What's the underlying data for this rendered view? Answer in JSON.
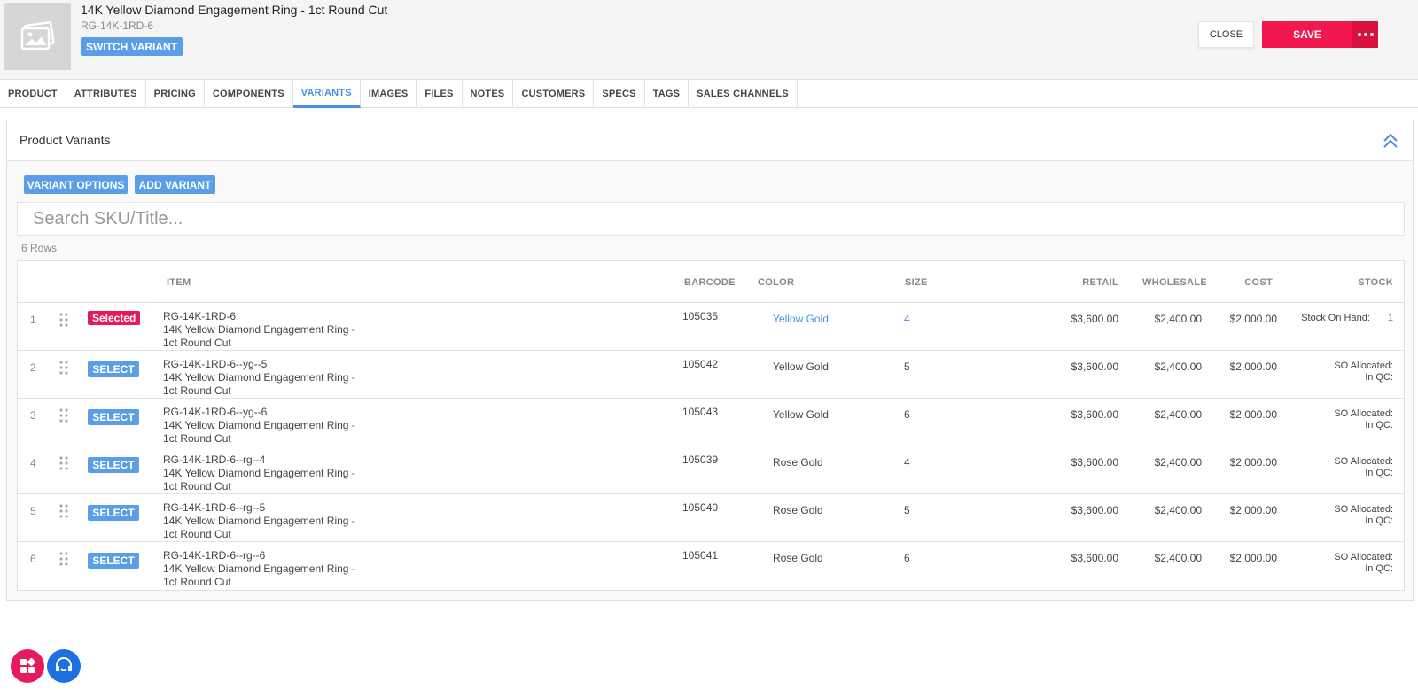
{
  "product": {
    "title": "14K Yellow Diamond Engagement Ring - 1ct Round Cut",
    "sku": "RG-14K-1RD-6",
    "switch_variant_label": "SWITCH VARIANT"
  },
  "actions": {
    "close_label": "CLOSE",
    "save_label": "SAVE"
  },
  "tabs": [
    {
      "label": "PRODUCT"
    },
    {
      "label": "ATTRIBUTES"
    },
    {
      "label": "PRICING"
    },
    {
      "label": "COMPONENTS"
    },
    {
      "label": "VARIANTS",
      "active": true
    },
    {
      "label": "IMAGES"
    },
    {
      "label": "FILES"
    },
    {
      "label": "NOTES"
    },
    {
      "label": "CUSTOMERS"
    },
    {
      "label": "SPECS"
    },
    {
      "label": "TAGS"
    },
    {
      "label": "SALES CHANNELS"
    }
  ],
  "panel": {
    "title": "Product Variants",
    "variant_options_label": "VARIANT OPTIONS",
    "add_variant_label": "ADD VARIANT",
    "search_placeholder": "Search SKU/Title...",
    "rows_count": "6 Rows"
  },
  "table": {
    "headers": {
      "item": "ITEM",
      "barcode": "BARCODE",
      "color": "COLOR",
      "size": "SIZE",
      "retail": "RETAIL",
      "wholesale": "WHOLESALE",
      "cost": "COST",
      "stock": "STOCK"
    },
    "select_label": "SELECT",
    "selected_label": "Selected",
    "rows": [
      {
        "num": "1",
        "sku": "RG-14K-1RD-6",
        "title1": "14K Yellow Diamond Engagement Ring -",
        "title2": "1ct Round Cut",
        "barcode": "105035",
        "color": "Yellow Gold",
        "size": "4",
        "retail": "$3,600.00",
        "wholesale": "$2,400.00",
        "cost": "$2,000.00",
        "stock1": "Stock On Hand:",
        "stock_value": "1",
        "selected": true
      },
      {
        "num": "2",
        "sku": "RG-14K-1RD-6--yg--5",
        "title1": "14K Yellow Diamond Engagement Ring -",
        "title2": "1ct Round Cut",
        "barcode": "105042",
        "color": "Yellow Gold",
        "size": "5",
        "retail": "$3,600.00",
        "wholesale": "$2,400.00",
        "cost": "$2,000.00",
        "stock1": "SO Allocated:",
        "stock2": "In QC:"
      },
      {
        "num": "3",
        "sku": "RG-14K-1RD-6--yg--6",
        "title1": "14K Yellow Diamond Engagement Ring -",
        "title2": "1ct Round Cut",
        "barcode": "105043",
        "color": "Yellow Gold",
        "size": "6",
        "retail": "$3,600.00",
        "wholesale": "$2,400.00",
        "cost": "$2,000.00",
        "stock1": "SO Allocated:",
        "stock2": "In QC:"
      },
      {
        "num": "4",
        "sku": "RG-14K-1RD-6--rg--4",
        "title1": "14K Yellow Diamond Engagement Ring -",
        "title2": "1ct Round Cut",
        "barcode": "105039",
        "color": "Rose Gold",
        "size": "4",
        "retail": "$3,600.00",
        "wholesale": "$2,400.00",
        "cost": "$2,000.00",
        "stock1": "SO Allocated:",
        "stock2": "In QC:"
      },
      {
        "num": "5",
        "sku": "RG-14K-1RD-6--rg--5",
        "title1": "14K Yellow Diamond Engagement Ring -",
        "title2": "1ct Round Cut",
        "barcode": "105040",
        "color": "Rose Gold",
        "size": "5",
        "retail": "$3,600.00",
        "wholesale": "$2,400.00",
        "cost": "$2,000.00",
        "stock1": "SO Allocated:",
        "stock2": "In QC:"
      },
      {
        "num": "6",
        "sku": "RG-14K-1RD-6--rg--6",
        "title1": "14K Yellow Diamond Engagement Ring -",
        "title2": "1ct Round Cut",
        "barcode": "105041",
        "color": "Rose Gold",
        "size": "6",
        "retail": "$3,600.00",
        "wholesale": "$2,400.00",
        "cost": "$2,000.00",
        "stock1": "SO Allocated:",
        "stock2": "In QC:"
      }
    ]
  },
  "colors": {
    "accent": "#4a90e2",
    "button_blue": "#5b9ee8",
    "save_red": "#f2174e",
    "selected_pink": "#e81b5a"
  },
  "icons": {
    "thumbnail": "image-placeholder-icon",
    "collapse": "double-chevron-up-icon",
    "more": "more-dots-icon",
    "drag": "drag-handle-icon",
    "fab1": "apps-icon",
    "fab2": "support-icon"
  }
}
